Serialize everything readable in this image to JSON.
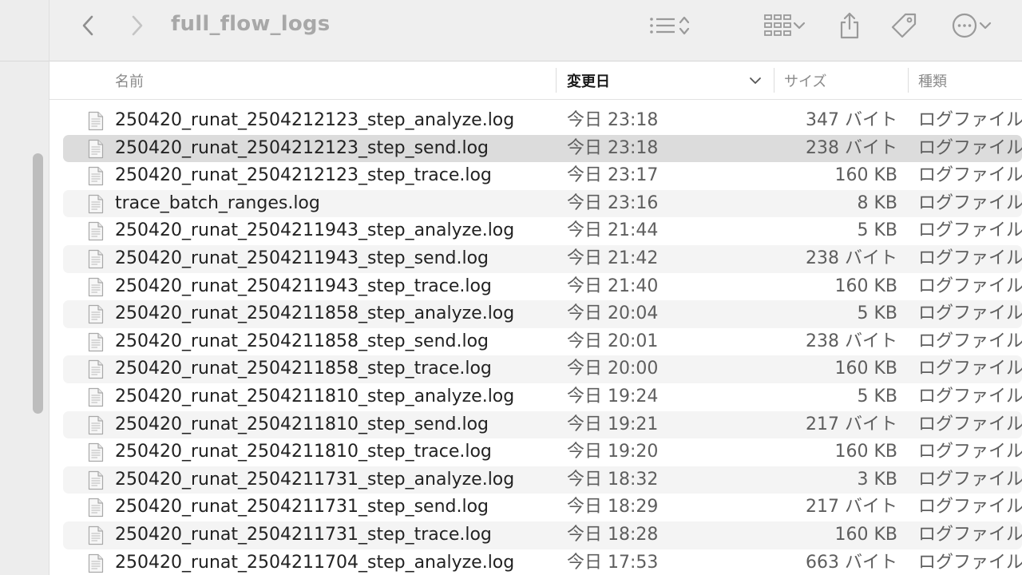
{
  "toolbar": {
    "title": "full_flow_logs",
    "back_icon": "chevron-left-icon",
    "forward_icon": "chevron-right-icon",
    "list_view_icon": "list-icon",
    "group_icon": "grid-icon",
    "share_icon": "share-icon",
    "tag_icon": "tag-icon",
    "more_icon": "ellipsis-icon"
  },
  "columns": {
    "name": "名前",
    "date": "変更日",
    "size": "サイズ",
    "kind": "種類"
  },
  "files": [
    {
      "name": "250420_runat_2504212123_step_analyze.log",
      "date": "今日 23:18",
      "size": "347 バイト",
      "kind": "ログファイル"
    },
    {
      "name": "250420_runat_2504212123_step_send.log",
      "date": "今日 23:18",
      "size": "238 バイト",
      "kind": "ログファイル"
    },
    {
      "name": "250420_runat_2504212123_step_trace.log",
      "date": "今日 23:17",
      "size": "160 KB",
      "kind": "ログファイル"
    },
    {
      "name": "trace_batch_ranges.log",
      "date": "今日 23:16",
      "size": "8 KB",
      "kind": "ログファイル"
    },
    {
      "name": "250420_runat_2504211943_step_analyze.log",
      "date": "今日 21:44",
      "size": "5 KB",
      "kind": "ログファイル"
    },
    {
      "name": "250420_runat_2504211943_step_send.log",
      "date": "今日 21:42",
      "size": "238 バイト",
      "kind": "ログファイル"
    },
    {
      "name": "250420_runat_2504211943_step_trace.log",
      "date": "今日 21:40",
      "size": "160 KB",
      "kind": "ログファイル"
    },
    {
      "name": "250420_runat_2504211858_step_analyze.log",
      "date": "今日 20:04",
      "size": "5 KB",
      "kind": "ログファイル"
    },
    {
      "name": "250420_runat_2504211858_step_send.log",
      "date": "今日 20:01",
      "size": "238 バイト",
      "kind": "ログファイル"
    },
    {
      "name": "250420_runat_2504211858_step_trace.log",
      "date": "今日 20:00",
      "size": "160 KB",
      "kind": "ログファイル"
    },
    {
      "name": "250420_runat_2504211810_step_analyze.log",
      "date": "今日 19:24",
      "size": "5 KB",
      "kind": "ログファイル"
    },
    {
      "name": "250420_runat_2504211810_step_send.log",
      "date": "今日 19:21",
      "size": "217 バイト",
      "kind": "ログファイル"
    },
    {
      "name": "250420_runat_2504211810_step_trace.log",
      "date": "今日 19:20",
      "size": "160 KB",
      "kind": "ログファイル"
    },
    {
      "name": "250420_runat_2504211731_step_analyze.log",
      "date": "今日 18:32",
      "size": "3 KB",
      "kind": "ログファイル"
    },
    {
      "name": "250420_runat_2504211731_step_send.log",
      "date": "今日 18:29",
      "size": "217 バイト",
      "kind": "ログファイル"
    },
    {
      "name": "250420_runat_2504211731_step_trace.log",
      "date": "今日 18:28",
      "size": "160 KB",
      "kind": "ログファイル"
    },
    {
      "name": "250420_runat_2504211704_step_analyze.log",
      "date": "今日 17:53",
      "size": "663 バイト",
      "kind": "ログファイル"
    }
  ],
  "selected_index": 1,
  "colors": {
    "selection": "#dcdcdc",
    "alt_row": "#f4f4f4",
    "toolbar_bg": "#efefef"
  }
}
